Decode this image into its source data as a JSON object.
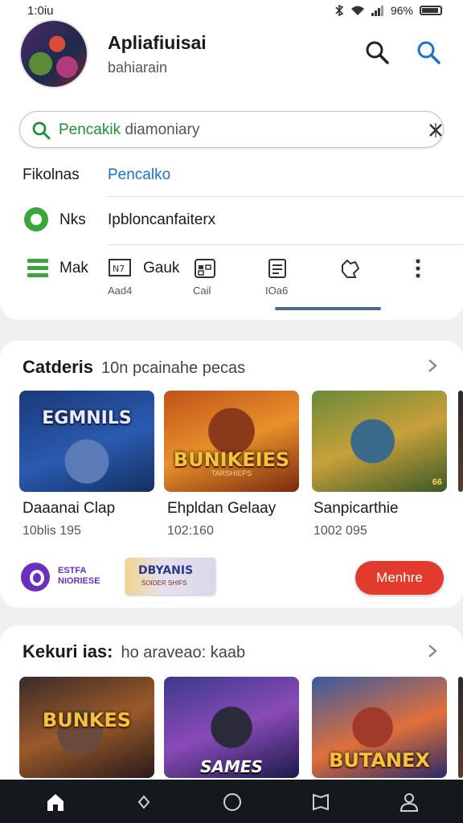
{
  "status_bar": {
    "time": "1:0iu",
    "battery": "96%"
  },
  "header": {
    "title": "Apliafiuisai",
    "subtitle": "bahiarain"
  },
  "search": {
    "value_highlight": "Pencakik",
    "value_rest": "diamoniary"
  },
  "rows": {
    "row1_label": "Fikolnas",
    "row1_link": "Pencalko",
    "row2_label": "Nks",
    "row2_text": "Ipbloncanfaiterx",
    "row3_label": "Mak"
  },
  "toolbar": {
    "items": [
      {
        "icon": "news-icon",
        "label": "Aad4",
        "inline_label": "Gauk"
      },
      {
        "icon": "calendar-icon",
        "label": "Cail"
      },
      {
        "icon": "document-icon",
        "label": "IOa6"
      },
      {
        "icon": "puzzle-icon",
        "label": ""
      },
      {
        "icon": "more-icon",
        "label": ""
      }
    ]
  },
  "section1": {
    "title": "Catderis",
    "subtitle": "10n pcainahe pecas",
    "games": [
      {
        "name": "Daaanai Clap",
        "meta": "10blis 195",
        "art_text": "EGMNILS",
        "art_sub": ""
      },
      {
        "name": "Ehpldan Gelaay",
        "meta": "102:160",
        "art_text": "BUNIKEIES",
        "art_sub": "TARSHIEPS"
      },
      {
        "name": "Sanpicarthie",
        "meta": "1002 095",
        "art_text": "",
        "art_sub": ""
      }
    ],
    "promo": {
      "logo_line1": "ESTFA",
      "logo_line2": "NIORIESE",
      "banner_title": "DBYANIS",
      "banner_sub": "SOIDER SHIFS",
      "button_label": "Menhre"
    }
  },
  "section2": {
    "title": "Kekuri ias:",
    "subtitle": "ho araveao: kaab",
    "games": [
      {
        "art_text": "BUNKES",
        "art_sub": ""
      },
      {
        "art_text": "SAMES",
        "art_sub": ""
      },
      {
        "art_text": "BUTANEX",
        "art_sub": ""
      }
    ]
  },
  "bottom_nav": {
    "items": [
      "home-icon",
      "diamond-icon",
      "circle-icon",
      "bookmark-icon",
      "profile-icon"
    ]
  },
  "colors": {
    "accent_green": "#1f8f3a",
    "accent_blue": "#1a73c8",
    "button_red": "#e23b2e",
    "nav_bg": "#15181c"
  }
}
